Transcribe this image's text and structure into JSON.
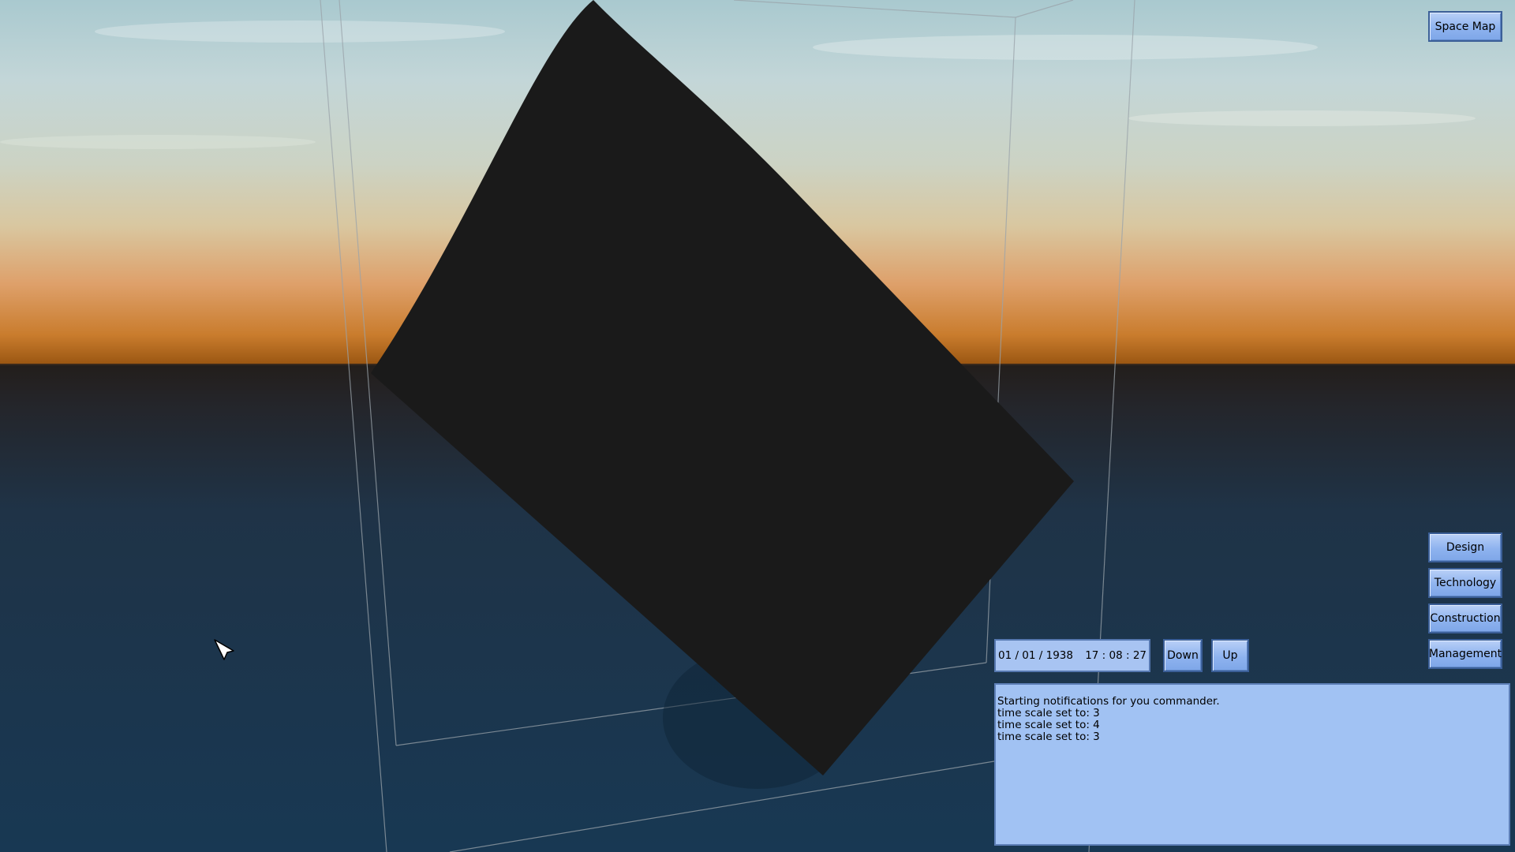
{
  "toolbar": {
    "space_map_label": "Space Map"
  },
  "side_menu": {
    "design_label": "Design",
    "technology_label": "Technology",
    "construction_label": "Construction",
    "management_label": "Management"
  },
  "time_control": {
    "date": "01 / 01 / 1938",
    "time": "17 : 08 : 27",
    "down_label": "Down",
    "up_label": "Up"
  },
  "notifications": [
    "Starting notifications for you commander.",
    "time scale set to: 3",
    "time scale set to: 4",
    "time scale set to: 3"
  ],
  "colors": {
    "button_fill": "#8eb3ef",
    "panel_fill": "#a1c2f3",
    "object_fill": "#1a1a1a",
    "horizon_glow": "#c77a28",
    "ocean": "#1d3a55"
  }
}
